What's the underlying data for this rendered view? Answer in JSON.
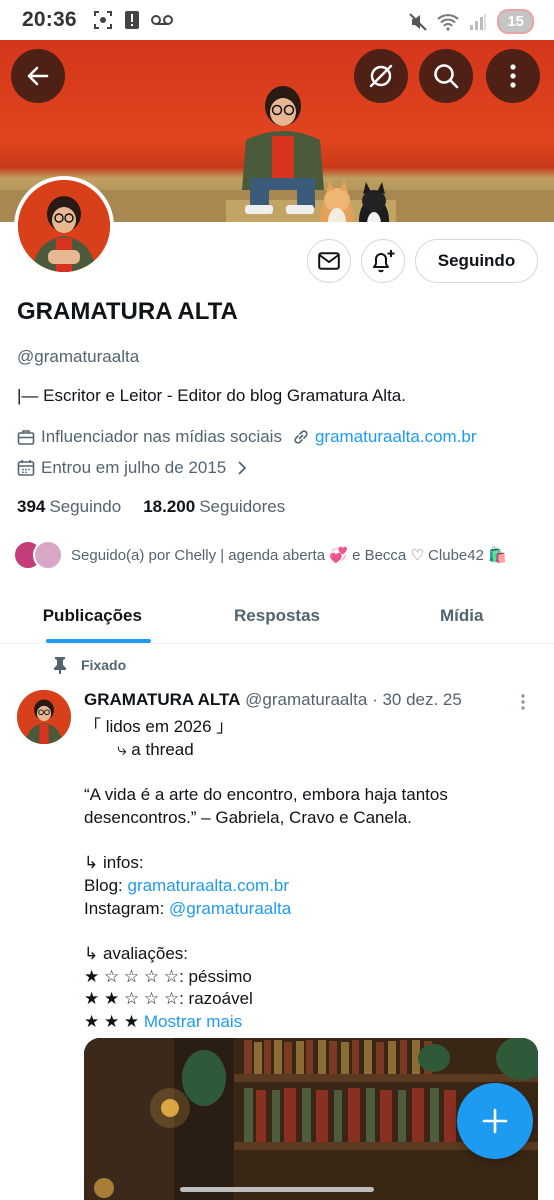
{
  "status_bar": {
    "time": "20:36",
    "battery": "15",
    "left_icons": [
      "screenshot-icon",
      "alert-icon",
      "voicemail-icon"
    ],
    "right_icons": [
      "mute-icon",
      "wifi-icon",
      "signal-icon"
    ]
  },
  "header": {
    "back_icon": "arrow-left-icon",
    "grok_icon": "grok-icon",
    "search_icon": "search-icon",
    "more_icon": "more-vertical-icon"
  },
  "profile": {
    "name": "GRAMATURA ALTA",
    "handle": "@gramaturaalta",
    "bio": "|— Escritor e Leitor - Editor do blog Gramatura Alta.",
    "category": "Influenciador nas mídias sociais",
    "website": "gramaturaalta.com.br",
    "joined": "Entrou em julho de 2015",
    "following_count": "394",
    "following_label": "Seguindo",
    "followers_count": "18.200",
    "followers_label": "Seguidores",
    "followed_by": "Seguido(a) por Chelly | agenda aberta 💞 e Becca ♡ Clube42 🛍️"
  },
  "actions": {
    "message_icon": "mail-icon",
    "notify_icon": "bell-plus-icon",
    "following_button": "Seguindo"
  },
  "tabs": [
    {
      "label": "Publicações",
      "active": true
    },
    {
      "label": "Respostas",
      "active": false
    },
    {
      "label": "Mídia",
      "active": false
    }
  ],
  "post": {
    "pinned_label": "Fixado",
    "author_name": "GRAMATURA ALTA",
    "author_handle": "@gramaturaalta",
    "date": "· 30 dez. 25",
    "title_line": "「 lidos em 2026 」",
    "thread_line": "       ⤷ a thread",
    "quote_line1": "“A vida é a arte do encontro, embora haja tantos",
    "quote_line2": "desencontros.” – Gabriela, Cravo e Canela.",
    "infos_label": "↳ infos:",
    "blog_label": "Blog: ",
    "blog_link": "gramaturaalta.com.br",
    "instagram_label": "Instagram: ",
    "instagram_link": "@gramaturaalta",
    "ratings_label": "↳ avaliações:",
    "rating_1": "★ ☆ ☆ ☆ ☆: péssimo",
    "rating_2": "★ ★ ☆ ☆ ☆: razoável",
    "rating_3_stars": "★ ★ ★ ",
    "show_more": "Mostrar mais"
  },
  "fab_icon": "plus-icon",
  "colors": {
    "accent": "#1d9bf0",
    "banner": "#e0451f",
    "text_secondary": "#536471"
  }
}
